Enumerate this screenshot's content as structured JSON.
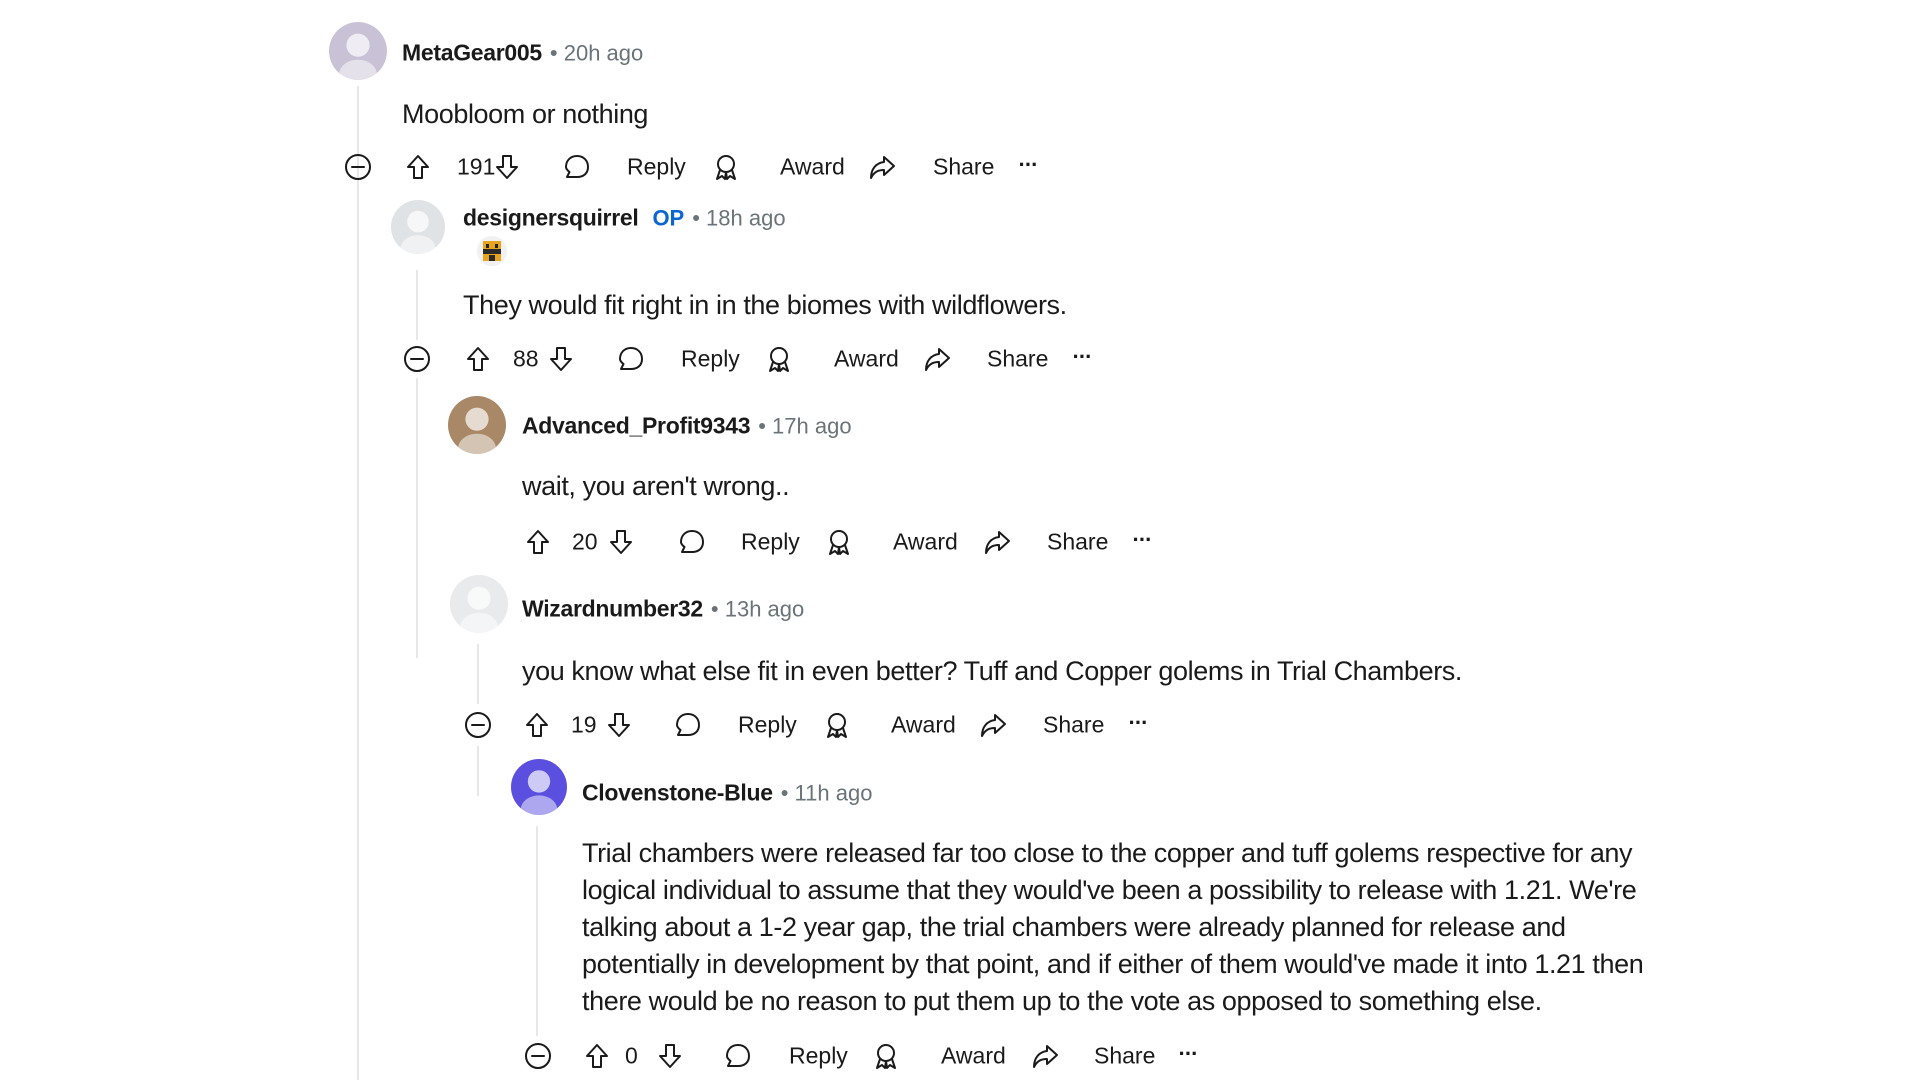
{
  "actions": {
    "reply": "Reply",
    "award": "Award",
    "share": "Share",
    "more": "···"
  },
  "comments": [
    {
      "author": "MetaGear005",
      "time": "• 20h ago",
      "body": [
        "Moobloom or nothing"
      ],
      "score": "191",
      "avatar_color": "#c9c2d6"
    },
    {
      "author": "designersquirrel",
      "op": "OP",
      "time": "• 18h ago",
      "body": [
        "They would fit right in in the biomes with wildflowers."
      ],
      "score": "88",
      "avatar_color": "#dfe3e6"
    },
    {
      "author": "Advanced_Profit9343",
      "time": "• 17h ago",
      "body": [
        "wait, you aren't wrong.."
      ],
      "score": "20",
      "avatar_color": "#a88866"
    },
    {
      "author": "Wizardnumber32",
      "time": "• 13h ago",
      "body": [
        "you know what else fit in even better? Tuff and Copper golems in Trial Chambers."
      ],
      "score": "19",
      "avatar_color": "#e8eaec"
    },
    {
      "author": "Clovenstone-Blue",
      "time": "• 11h ago",
      "body": [
        "Trial chambers were released far too close to the copper and tuff golems respective for any",
        "logical individual to assume that they would've been a possibility to release with 1.21. We're",
        "talking about a 1-2 year gap, the trial chambers were already planned for release and",
        "potentially in development by that point, and if either of them would've made it into 1.21 then",
        "there would be no reason to put them up to the vote as opposed to something else."
      ],
      "score": "0",
      "avatar_color": "#5b4fe0"
    }
  ],
  "colors": {
    "op": "#0a66d1",
    "meta": "#6a7378",
    "thread_line": "#e5e7e9"
  }
}
